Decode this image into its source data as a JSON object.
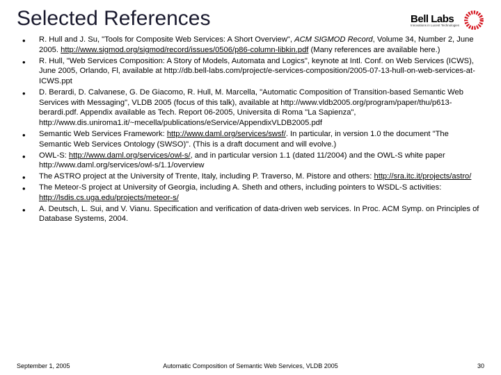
{
  "header": {
    "title": "Selected References",
    "logo_text": "Bell Labs",
    "logo_sub": "Innovations in Lucent Technologies"
  },
  "refs": {
    "r1_a": "R. Hull and J. Su, \"Tools for Composite Web Services: A Short Overview\", ",
    "r1_i": "ACM SIGMOD Record",
    "r1_b": ", Volume 34, Number 2, June 2005. ",
    "r1_u": "http://www.sigmod.org/sigmod/record/issues/0506/p86-column-libkin.pdf",
    "r1_c": " (Many references are available here.)",
    "r2": "R. Hull, \"Web Services Composition: A Story of Models, Automata and Logics\", keynote at Intl. Conf. on Web Services (ICWS), June 2005, Orlando, Fl, available at http://db.bell-labs.com/project/e-services-composition/2005-07-13-hull-on-web-services-at-ICWS.ppt",
    "r3": "D. Berardi, D. Calvanese, G. De Giacomo, R. Hull, M. Marcella, \"Automatic Composition of Transition-based Semantic Web Services with Messaging\", VLDB 2005 (focus of this talk), available at  http://www.vldb2005.org/program/paper/thu/p613-berardi.pdf.  Appendix available as Tech. Report 06-2005, Universita di Roma \"La Sapienza\", http://www.dis.uniroma1.it/~mecella/publications/eService/AppendixVLDB2005.pdf",
    "r4_a": "Semantic Web Services Framework: ",
    "r4_u": "http://www.daml.org/services/swsf/",
    "r4_b": ".  In particular, in version 1.0 the document \"The Semantic Web Services Ontology (SWSO)\".  (This is a draft document and will evolve.)",
    "r5_a": "OWL-S: ",
    "r5_u": "http://www.daml.org/services/owl-s/",
    "r5_b": ", and in particular version 1.1 (dated 11/2004) and the OWL-S white paper http://www.daml.org/services/owl-s/1.1/overview",
    "r6_a": "The ASTRO project at the University of Trente, Italy, including P. Traverso, M. Pistore and others: ",
    "r6_u": "http://sra.itc.it/projects/astro/",
    "r7_a": "The Meteor-S project at University of Georgia, including A. Sheth and others, including pointers to WSDL-S activities: ",
    "r7_u": "http://lsdis.cs.uga.edu/projects/meteor-s/",
    "r8": "A. Deutsch, L. Sui, and V. Vianu. Specification and verification of data-driven web services. In Proc. ACM Symp. on Principles of Database Systems, 2004."
  },
  "footer": {
    "date": "September 1, 2005",
    "center": "Automatic Composition of Semantic Web Services, VLDB 2005",
    "page": "30"
  }
}
